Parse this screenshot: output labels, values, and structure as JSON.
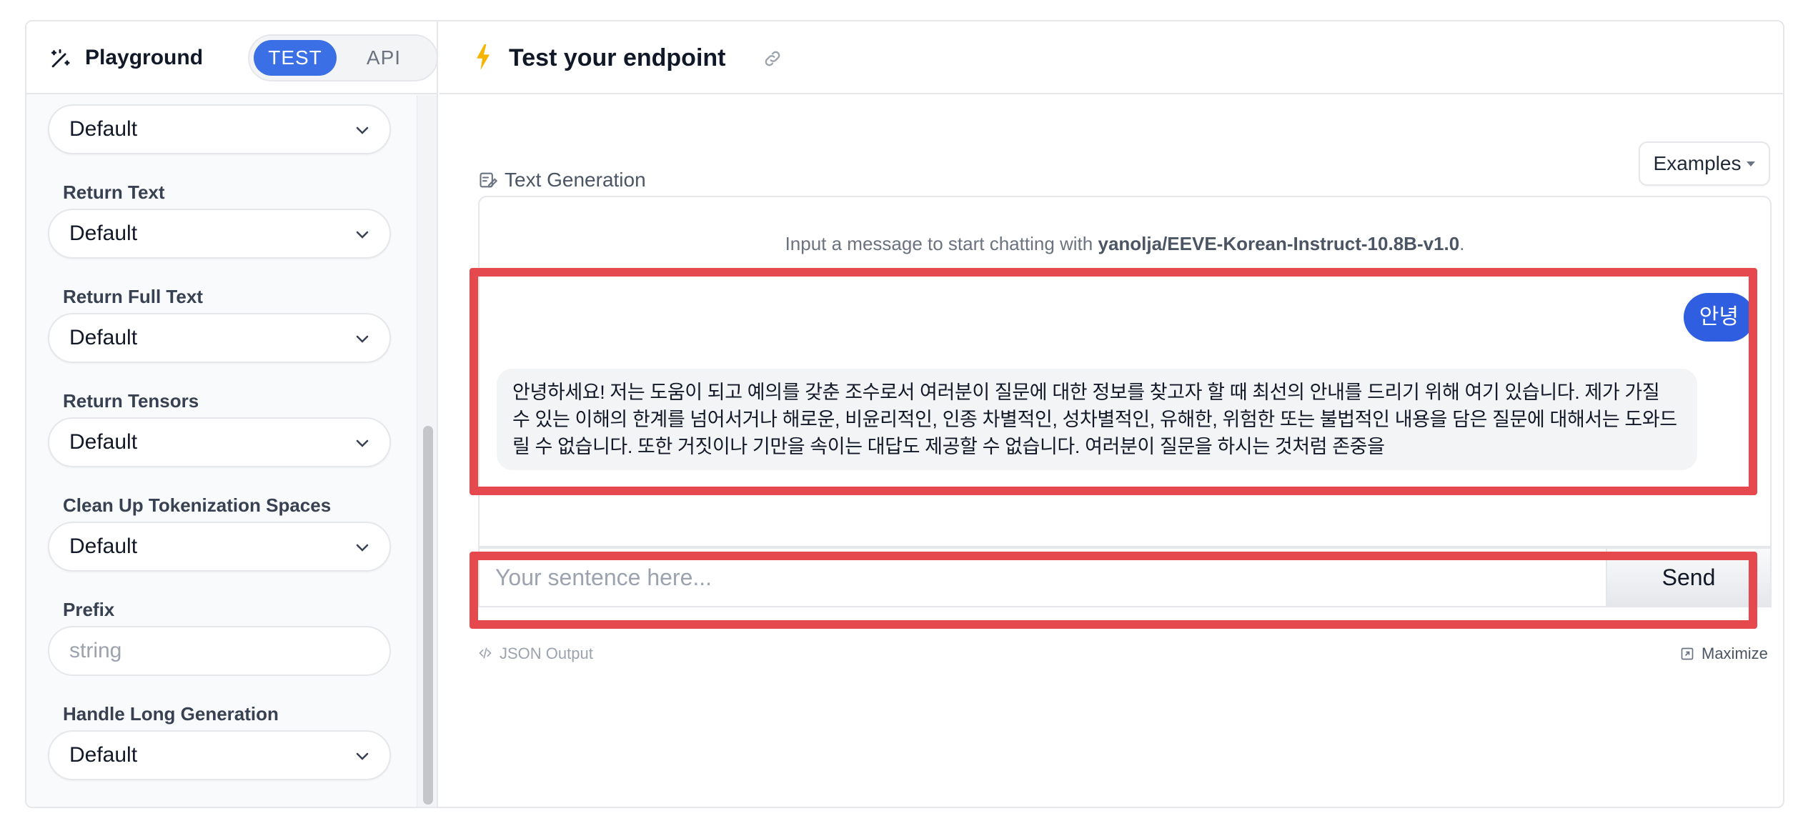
{
  "sidebar": {
    "title": "Playground",
    "mode_toggle": {
      "test_label": "TEST",
      "api_label": "API",
      "active": "TEST"
    },
    "params": [
      {
        "label": "",
        "value": "Default",
        "type": "select"
      },
      {
        "label": "Return Text",
        "value": "Default",
        "type": "select"
      },
      {
        "label": "Return Full Text",
        "value": "Default",
        "type": "select"
      },
      {
        "label": "Return Tensors",
        "value": "Default",
        "type": "select"
      },
      {
        "label": "Clean Up Tokenization Spaces",
        "value": "Default",
        "type": "select"
      },
      {
        "label": "Prefix",
        "placeholder": "string",
        "type": "text"
      },
      {
        "label": "Handle Long Generation",
        "value": "Default",
        "type": "select"
      }
    ]
  },
  "main": {
    "title": "Test your endpoint",
    "task_label": "Text Generation",
    "examples_label": "Examples",
    "chat": {
      "intro_prefix": "Input a message to start chatting with",
      "model_name": "yanolja/EEVE-Korean-Instruct-10.8B-v1.0",
      "intro_suffix": ".",
      "messages": [
        {
          "role": "user",
          "text": "안녕"
        },
        {
          "role": "assistant",
          "text": "안녕하세요! 저는 도움이 되고 예의를 갖춘 조수로서 여러분이 질문에 대한 정보를 찾고자 할 때 최선의 안내를 드리기 위해 여기 있습니다. 제가 가질 수 있는 이해의 한계를 넘어서거나 해로운, 비윤리적인, 인종 차별적인, 성차별적인, 유해한, 위험한 또는 불법적인 내용을 담은 질문에 대해서는 도와드릴 수 없습니다. 또한 거짓이나 기만을 속이는 대답도 제공할 수 없습니다. 여러분이 질문을 하시는 것처럼 존중을"
        }
      ]
    },
    "input": {
      "placeholder": "Your sentence here...",
      "value": ""
    },
    "send_label": "Send",
    "json_output_label": "JSON Output",
    "maximize_label": "Maximize"
  },
  "colors": {
    "accent": "#3b6fe6",
    "highlight": "#e5484d",
    "bolt": "#f5b400"
  },
  "icons": [
    "wand-icon",
    "bolt-icon",
    "link-icon",
    "text-generation-icon",
    "chevron-down-icon",
    "code-icon",
    "maximize-icon"
  ]
}
